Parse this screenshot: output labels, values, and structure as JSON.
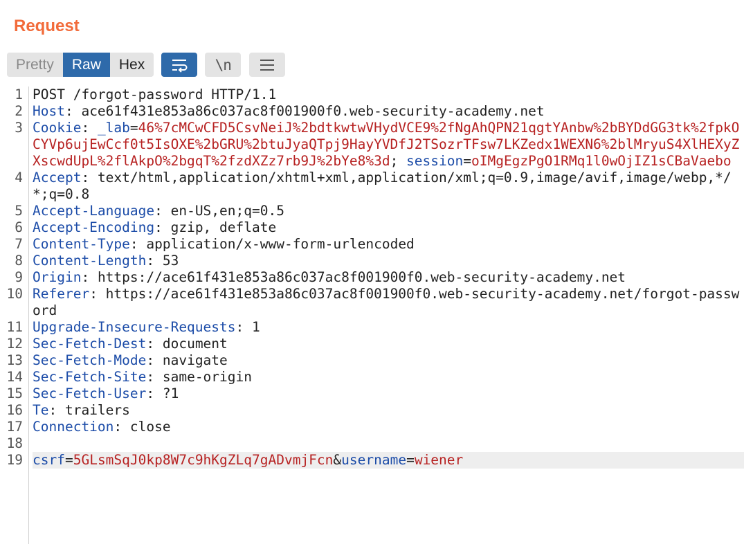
{
  "panel": {
    "title": "Request"
  },
  "tabs": [
    {
      "label": "Pretty"
    },
    {
      "label": "Raw"
    },
    {
      "label": "Hex"
    }
  ],
  "tools": {
    "wrap_icon": "wrap-lines-icon",
    "newline_glyph": "\\n",
    "menu_icon": "hamburger-menu-icon"
  },
  "colors": {
    "title": "#f26b3a",
    "active": "#2e6aaa",
    "header_name": "#1c4ca8",
    "param_value": "#b72222"
  },
  "request": {
    "l1": {
      "text": "POST /forgot-password HTTP/1.1"
    },
    "l2": {
      "name": "Host",
      "value": "ace61f431e853a86c037ac8f001900f0.web-security-academy.net"
    },
    "l3": {
      "name": "Cookie",
      "c1_name": "_lab",
      "c1_value": "46%7cMCwCFD5CsvNeiJ%2bdtkwtwVHydVCE9%2fNgAhQPN21qgtYAnbw%2bBYDdGG3tk%2fpkOCYVp6ujEwCcf0t5IsOXE%2bGRU%2btuJyaQTpj9HayYVDfJ2TSozrTFsw7LKZedx1WEXN6%2blMryuS4XlHEXyZXscwdUpL%2flAkpO%2bgqT%2fzdXZz7rb9J%2bYe8%3d",
      "c2_name": "session",
      "c2_value": "oIMgEgzPgO1RMq1l0wOjIZ1sCBaVaebo"
    },
    "l4": {
      "name": "Accept",
      "value": "text/html,application/xhtml+xml,application/xml;q=0.9,image/avif,image/webp,*/*;q=0.8"
    },
    "l5": {
      "name": "Accept-Language",
      "value": "en-US,en;q=0.5"
    },
    "l6": {
      "name": "Accept-Encoding",
      "value": "gzip, deflate"
    },
    "l7": {
      "name": "Content-Type",
      "value": "application/x-www-form-urlencoded"
    },
    "l8": {
      "name": "Content-Length",
      "value": "53"
    },
    "l9": {
      "name": "Origin",
      "value": "https://ace61f431e853a86c037ac8f001900f0.web-security-academy.net"
    },
    "l10": {
      "name": "Referer",
      "value": "https://ace61f431e853a86c037ac8f001900f0.web-security-academy.net/forgot-password"
    },
    "l11": {
      "name": "Upgrade-Insecure-Requests",
      "value": "1"
    },
    "l12": {
      "name": "Sec-Fetch-Dest",
      "value": "document"
    },
    "l13": {
      "name": "Sec-Fetch-Mode",
      "value": "navigate"
    },
    "l14": {
      "name": "Sec-Fetch-Site",
      "value": "same-origin"
    },
    "l15": {
      "name": "Sec-Fetch-User",
      "value": "?1"
    },
    "l16": {
      "name": "Te",
      "value": "trailers"
    },
    "l17": {
      "name": "Connection",
      "value": "close"
    },
    "l19": {
      "p1_name": "csrf",
      "p1_value": "5GLsmSqJ0kp8W7c9hKgZLq7gADvmjFcn",
      "p2_name": "username",
      "p2_value": "wiener"
    }
  },
  "line_numbers": [
    "1",
    "2",
    "3",
    "4",
    "5",
    "6",
    "7",
    "8",
    "9",
    "10",
    "11",
    "12",
    "13",
    "14",
    "15",
    "16",
    "17",
    "18",
    "19"
  ]
}
